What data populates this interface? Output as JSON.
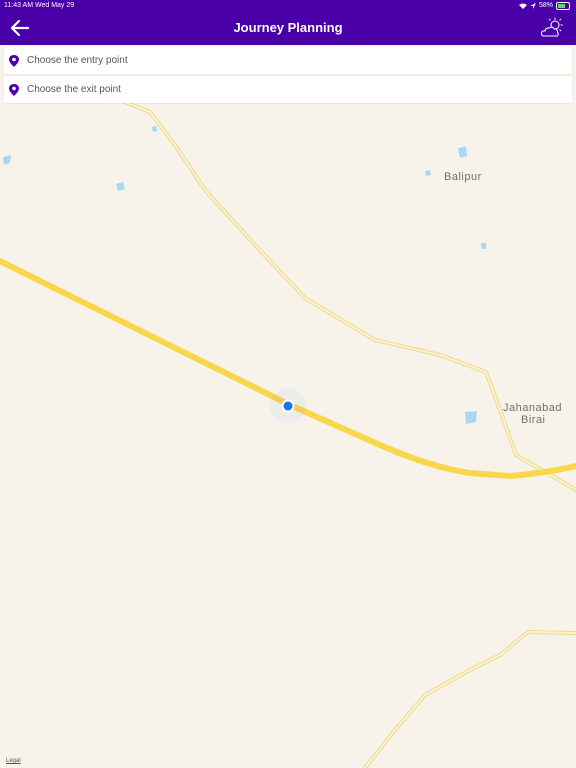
{
  "status_bar": {
    "time_date": "11:43 AM   Wed May 29",
    "battery": "58%"
  },
  "header": {
    "title": "Journey Planning"
  },
  "search": {
    "entry_placeholder": "Choose the entry point",
    "exit_placeholder": "Choose the exit point"
  },
  "map": {
    "places": [
      {
        "name": "Balipur"
      },
      {
        "name": "Jahanabad"
      },
      {
        "name": "Birai"
      }
    ],
    "legal": "Legal"
  },
  "colors": {
    "header": "#4a00a8",
    "map_bg": "#f8f3ea",
    "major_road": "#f8d64e",
    "minor_road": "#f2dc93",
    "water": "#a6d8f4",
    "location_dot": "#1a73e8",
    "pin": "#4a00a8"
  },
  "icons": [
    "back-arrow-icon",
    "weather-cloud-sun-icon",
    "location-pin-icon",
    "current-location-dot"
  ]
}
